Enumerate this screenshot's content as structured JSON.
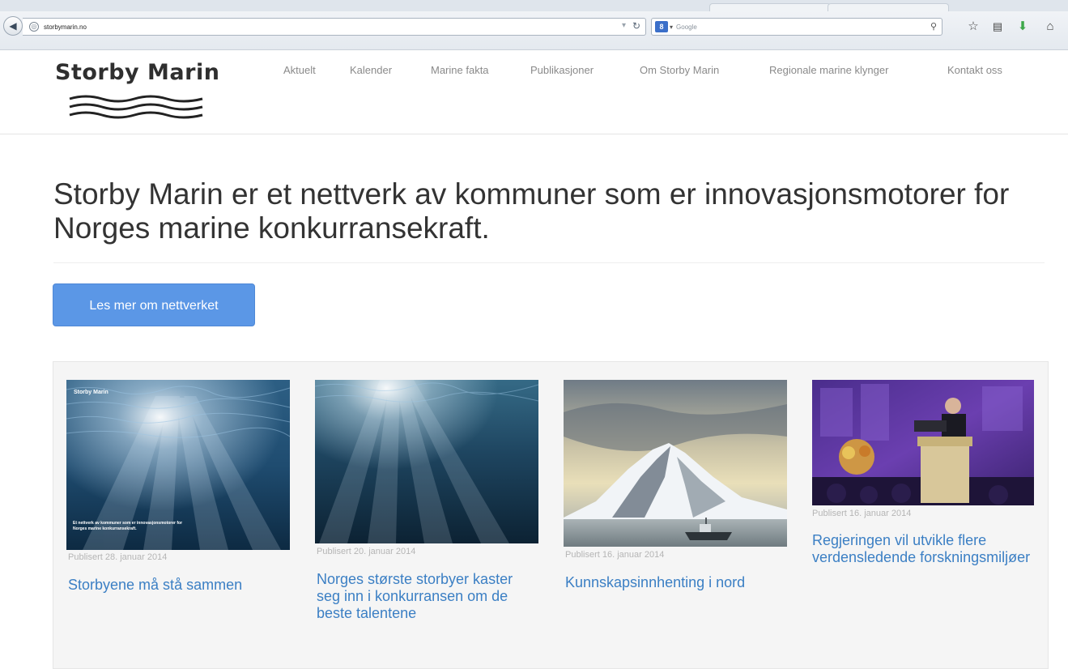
{
  "browser": {
    "url": "storbymarin.no",
    "search_placeholder": "Google",
    "search_engine_icon": "google-icon",
    "toolbar_icons": [
      "star-icon",
      "bookmarks-icon",
      "download-icon",
      "home-icon"
    ]
  },
  "site": {
    "logo": "Storby Marin",
    "nav": [
      "Aktuelt",
      "Kalender",
      "Marine fakta",
      "Publikasjoner",
      "Om Storby Marin",
      "Regionale marine klynger",
      "Kontakt oss"
    ]
  },
  "hero": {
    "title": "Storby Marin er et nettverk av kommuner som er innovasjonsmotorer for Norges marine konkurransekraft.",
    "cta": "Les mer om nettverket"
  },
  "cards": [
    {
      "date": "Publisert 28. januar 2014",
      "title": "Storbyene må stå sammen",
      "image_overlay_title": "Storby Marin",
      "image_overlay_text": "Et nettverk av kommuner som er innovasjonsmotorer for Norges marine konkurransekraft."
    },
    {
      "date": "Publisert 20. januar 2014",
      "title": "Norges største storbyer kaster seg inn i konkurransen om de beste talentene"
    },
    {
      "date": "Publisert 16. januar 2014",
      "title": "Kunnskapsinnhenting i nord"
    },
    {
      "date": "Publisert 16. januar 2014",
      "title": "Regjeringen vil utvikle flere verdensledende forskningsmiljøer"
    }
  ],
  "colors": {
    "accent": "#5b97e6",
    "link": "#3b7fc4",
    "text": "#333333",
    "nav": "#8a8a8a"
  }
}
